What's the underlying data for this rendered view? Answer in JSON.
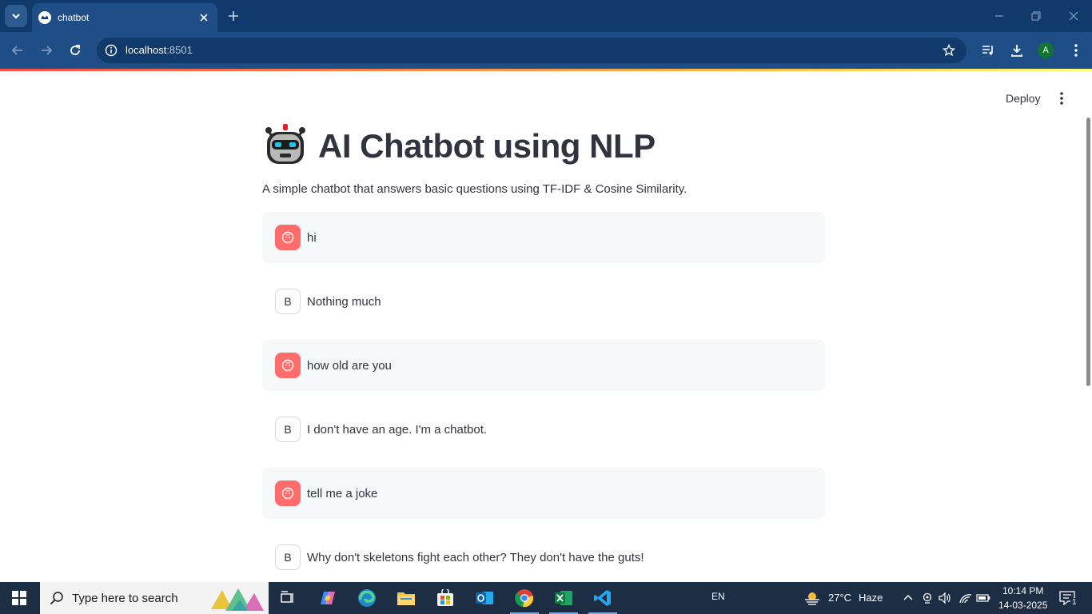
{
  "browser": {
    "tab_title": "chatbot",
    "url_host": "localhost",
    "url_port": ":8501",
    "profile_initial": "A"
  },
  "app": {
    "deploy_label": "Deploy",
    "title": "AI Chatbot using NLP",
    "title_icon": "robot-emoji-icon",
    "subtitle": "A simple chatbot that answers basic questions using TF-IDF & Cosine Similarity.",
    "bot_avatar_letter": "B",
    "messages": [
      {
        "role": "user",
        "text": "hi"
      },
      {
        "role": "bot",
        "text": "Nothing much"
      },
      {
        "role": "user",
        "text": "how old are you"
      },
      {
        "role": "bot",
        "text": "I don't have an age. I'm a chatbot."
      },
      {
        "role": "user",
        "text": "tell me a joke"
      },
      {
        "role": "bot",
        "text": "Why don't skeletons fight each other? They don't have the guts!"
      }
    ]
  },
  "taskbar": {
    "search_placeholder": "Type here to search",
    "language": "EN",
    "weather_temp": "27°C",
    "weather_desc": "Haze",
    "time": "10:14 PM",
    "date": "14-03-2025",
    "notification_count": "1"
  },
  "colors": {
    "accent_red": "#ff4b4b",
    "user_avatar": "#ff6c6c",
    "chrome_dark": "#103a6b",
    "chrome_toolbar": "#1f4e86"
  }
}
